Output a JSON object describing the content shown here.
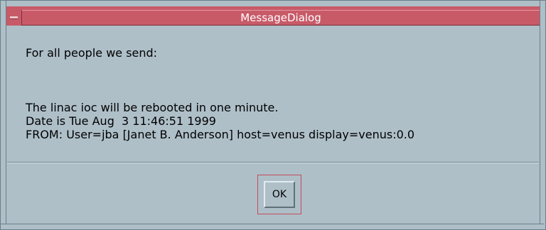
{
  "window": {
    "title": "MessageDialog"
  },
  "message": {
    "lines": [
      "For all people we send:",
      "",
      "The linac ioc will be rebooted in one minute.",
      "Date is Tue Aug  3 11:46:51 1999",
      "FROM: User=jba [Janet B. Anderson] host=venus display=venus:0.0"
    ]
  },
  "buttons": {
    "ok_label": "OK"
  },
  "colors": {
    "titlebar": "#c85a68",
    "background": "#aebfc8",
    "default_button_ring": "#c24c5c"
  },
  "icons": {
    "window_menu": "window-menu-icon"
  }
}
